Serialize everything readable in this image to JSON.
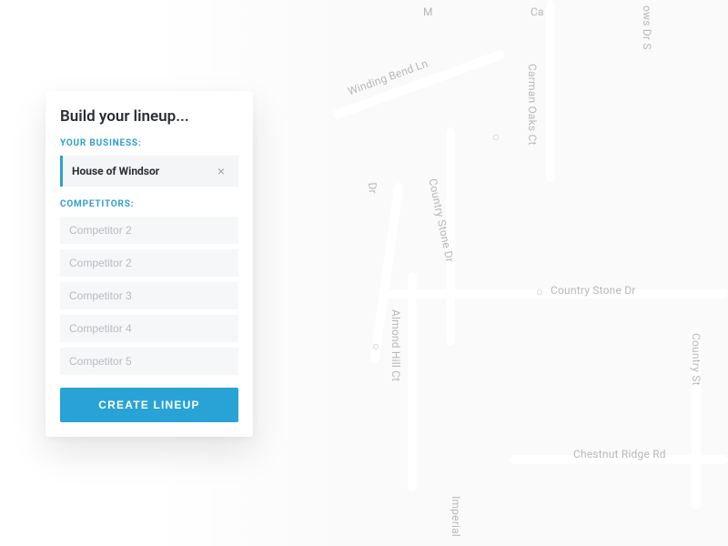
{
  "card": {
    "title": "Build your lineup...",
    "business_label": "YOUR BUSINESS:",
    "business_name": "House of Windsor",
    "clear_symbol": "×",
    "competitors_label": "COMPETITORS:",
    "competitors": [
      {
        "placeholder": "Competitor 2"
      },
      {
        "placeholder": "Competitor 2"
      },
      {
        "placeholder": "Competitor 3"
      },
      {
        "placeholder": "Competitor 4"
      },
      {
        "placeholder": "Competitor 5"
      }
    ],
    "create_label": "CREATE LINEUP"
  },
  "map": {
    "streets": [
      "Winding Bend Ln",
      "Carman Oaks Ct",
      "Country Stone Dr",
      "Country Stone Dr",
      "Almond Hill Ct",
      "Chestnut Ridge Rd",
      "Imperial"
    ]
  },
  "colors": {
    "accent": "#29a3d6",
    "label": "#2f9fd0",
    "text": "#2a2e33",
    "muted": "#b7bcc2"
  }
}
